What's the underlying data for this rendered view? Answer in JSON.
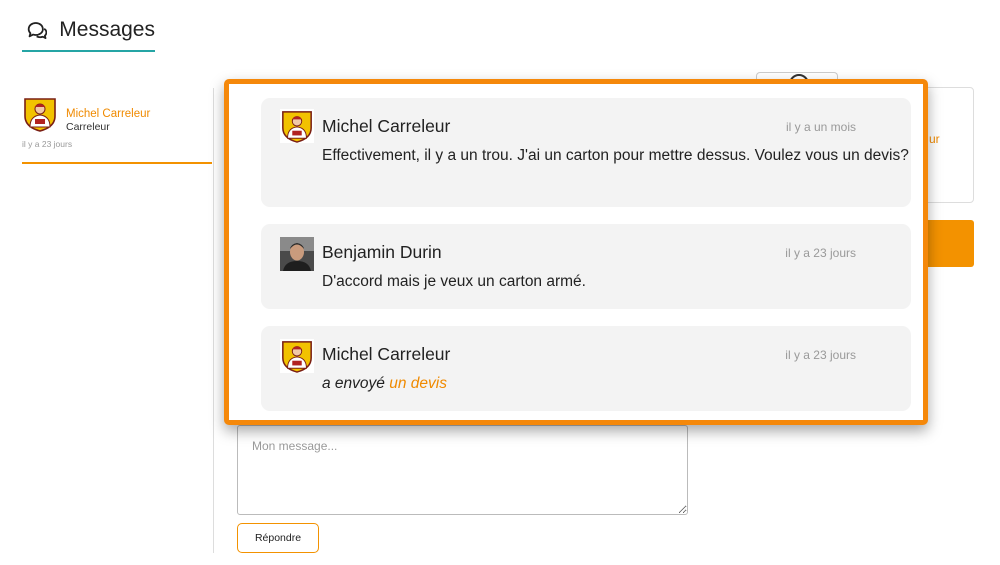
{
  "header": {
    "title": "Messages",
    "icon": "chat-bubbles-icon"
  },
  "conversation": {
    "name": "Michel Carreleur",
    "role": "Carreleur",
    "time": "il y a 23 jours"
  },
  "messages": [
    {
      "author": "Michel Carreleur",
      "time": "il y a un mois",
      "text": "Effectivement, il y a un trou. J'ai un carton pour mettre dessus. Voulez vous un devis?"
    },
    {
      "author": "Benjamin Durin",
      "time": "il y a 23 jours",
      "text": "D'accord mais je veux un carton armé."
    },
    {
      "author": "Michel Carreleur",
      "time": "il y a 23 jours",
      "sent_prefix": "a envoyé",
      "sent_link": "un devis"
    }
  ],
  "right_panel": {
    "fragment": "ur"
  },
  "reply": {
    "placeholder": "Mon message...",
    "button": "Répondre"
  },
  "colors": {
    "accent": "#f39200",
    "teal": "#25a5a5",
    "bubble": "#f3f3f3"
  }
}
